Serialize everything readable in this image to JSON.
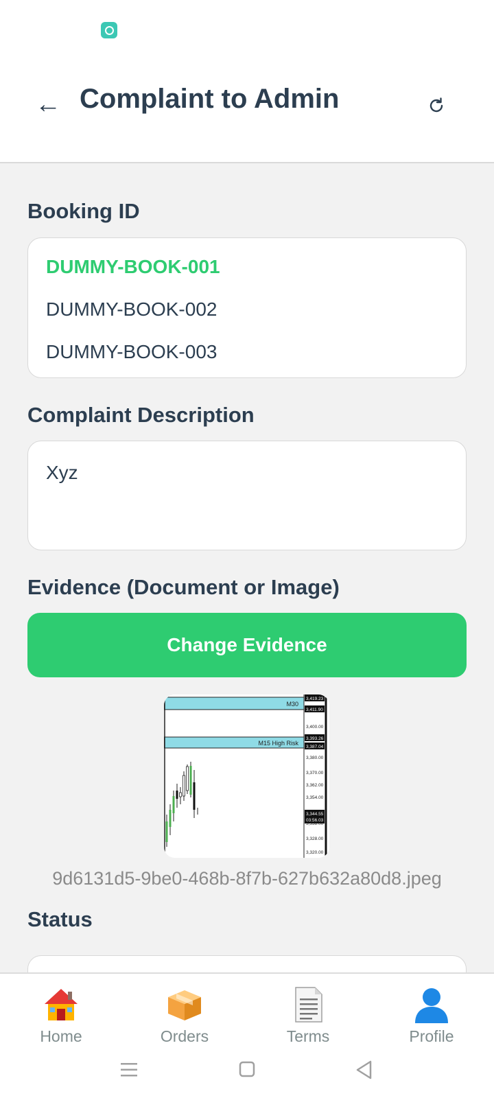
{
  "header": {
    "back_icon": "arrow-left-icon",
    "back_glyph": "←",
    "title": "Complaint to Admin",
    "refresh_icon": "refresh-icon"
  },
  "form": {
    "booking_label": "Booking ID",
    "bookings": [
      {
        "id": "DUMMY-BOOK-001",
        "selected": true
      },
      {
        "id": "DUMMY-BOOK-002",
        "selected": false
      },
      {
        "id": "DUMMY-BOOK-003",
        "selected": false
      }
    ],
    "description_label": "Complaint Description",
    "description_value": "Xyz",
    "evidence_label": "Evidence (Document or Image)",
    "change_evidence_label": "Change Evidence",
    "evidence_filename": "9d6131d5-9be0-468b-8f7b-627b632a80d8.jpeg",
    "status_label": "Status"
  },
  "evidence_image": {
    "bands": [
      "M30",
      "M15 High Risk"
    ],
    "prices": [
      "3,419.23",
      "3,411.90",
      "3,400.00",
      "3,393.26",
      "3,387.04",
      "3,380.00",
      "3,370.00",
      "3,362.00",
      "3,354.00",
      "3,344.55",
      "03:56.03",
      "3,338.00",
      "3,328.00",
      "3,320.00"
    ]
  },
  "nav": {
    "items": [
      {
        "label": "Home",
        "icon": "house-icon"
      },
      {
        "label": "Orders",
        "icon": "package-icon"
      },
      {
        "label": "Terms",
        "icon": "document-icon"
      },
      {
        "label": "Profile",
        "icon": "person-icon"
      }
    ]
  },
  "colors": {
    "accent": "#2ecc71",
    "text": "#2c3e50",
    "muted": "#8a8a8a",
    "background": "#f2f2f2"
  }
}
